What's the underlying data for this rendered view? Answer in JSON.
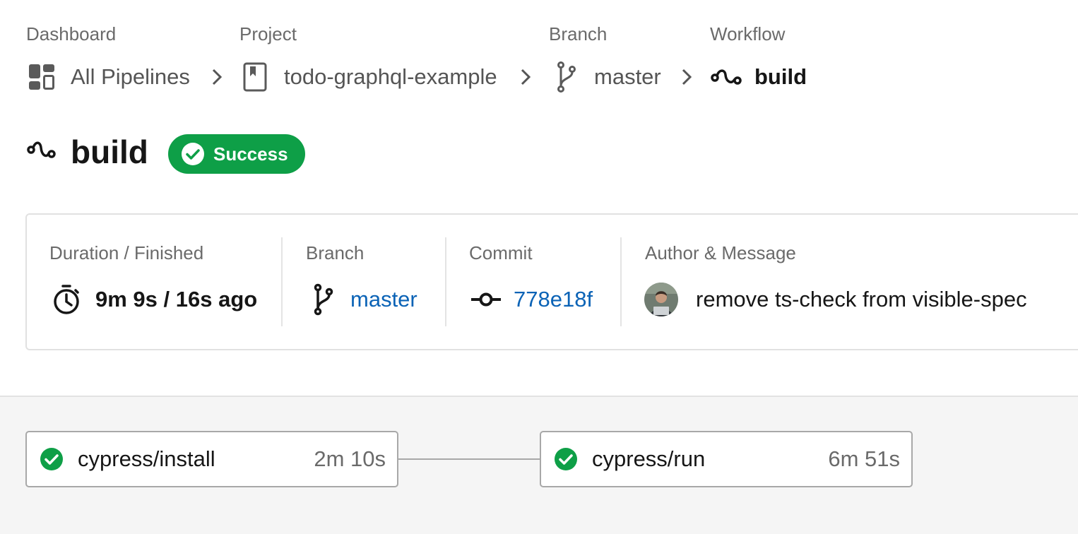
{
  "breadcrumbs": {
    "labels": {
      "dashboard": "Dashboard",
      "project": "Project",
      "branch": "Branch",
      "workflow": "Workflow"
    },
    "items": {
      "dashboard": {
        "text": "All Pipelines",
        "icon": "dashboard-grid-icon"
      },
      "project": {
        "text": "todo-graphql-example",
        "icon": "bookmark-icon"
      },
      "branch": {
        "text": "master",
        "icon": "git-branch-icon"
      },
      "workflow": {
        "text": "build",
        "icon": "workflow-icon"
      }
    },
    "separator_icon": "chevron-right-icon"
  },
  "workflow": {
    "title": "build",
    "icon": "workflow-icon",
    "status": {
      "label": "Success",
      "color": "#0e9f47",
      "icon": "check-circle-icon"
    }
  },
  "summary": {
    "duration": {
      "label": "Duration / Finished",
      "value": "9m 9s / 16s ago",
      "icon": "stopwatch-icon"
    },
    "branch": {
      "label": "Branch",
      "value": "master",
      "icon": "git-branch-icon"
    },
    "commit": {
      "label": "Commit",
      "value": "778e18f",
      "icon": "commit-icon"
    },
    "author": {
      "label": "Author & Message",
      "message": "remove ts-check from visible-spec",
      "icon": "avatar"
    }
  },
  "jobs": [
    {
      "name": "cypress/install",
      "duration": "2m 10s",
      "status": "success",
      "icon": "check-circle-icon"
    },
    {
      "name": "cypress/run",
      "duration": "6m 51s",
      "status": "success",
      "icon": "check-circle-icon"
    }
  ],
  "colors": {
    "success": "#0e9f47",
    "link": "#0b63b6",
    "text_primary": "#161616",
    "text_secondary": "#6a6a6a"
  }
}
